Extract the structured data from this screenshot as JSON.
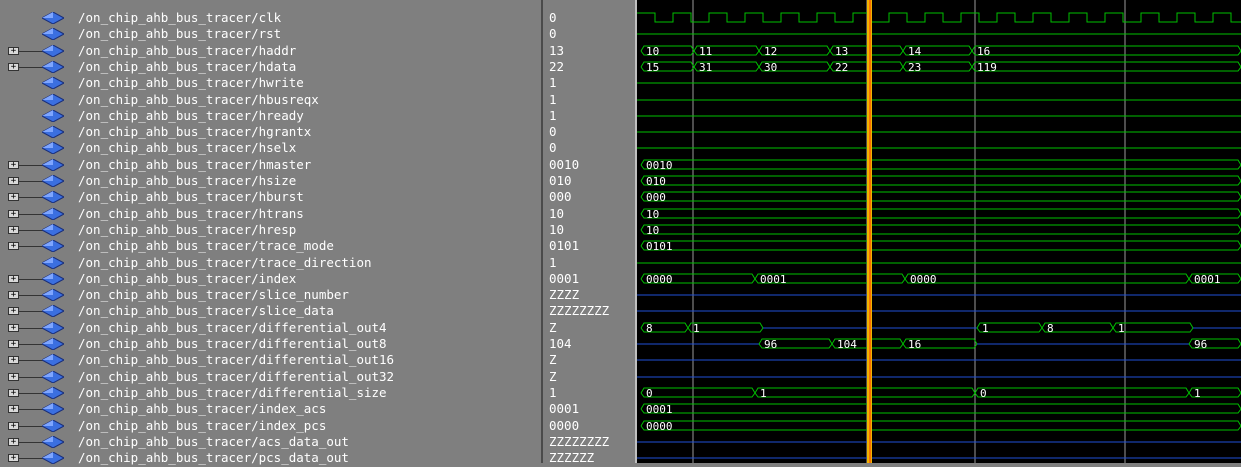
{
  "signals": [
    {
      "name": "/on_chip_ahb_bus_tracer/clk",
      "value": "0",
      "bus": false
    },
    {
      "name": "/on_chip_ahb_bus_tracer/rst",
      "value": "0",
      "bus": false
    },
    {
      "name": "/on_chip_ahb_bus_tracer/haddr",
      "value": "13",
      "bus": true
    },
    {
      "name": "/on_chip_ahb_bus_tracer/hdata",
      "value": "22",
      "bus": true
    },
    {
      "name": "/on_chip_ahb_bus_tracer/hwrite",
      "value": "1",
      "bus": false
    },
    {
      "name": "/on_chip_ahb_bus_tracer/hbusreqx",
      "value": "1",
      "bus": false
    },
    {
      "name": "/on_chip_ahb_bus_tracer/hready",
      "value": "1",
      "bus": false
    },
    {
      "name": "/on_chip_ahb_bus_tracer/hgrantx",
      "value": "0",
      "bus": false
    },
    {
      "name": "/on_chip_ahb_bus_tracer/hselx",
      "value": "0",
      "bus": false
    },
    {
      "name": "/on_chip_ahb_bus_tracer/hmaster",
      "value": "0010",
      "bus": true
    },
    {
      "name": "/on_chip_ahb_bus_tracer/hsize",
      "value": "010",
      "bus": true
    },
    {
      "name": "/on_chip_ahb_bus_tracer/hburst",
      "value": "000",
      "bus": true
    },
    {
      "name": "/on_chip_ahb_bus_tracer/htrans",
      "value": "10",
      "bus": true
    },
    {
      "name": "/on_chip_ahb_bus_tracer/hresp",
      "value": "10",
      "bus": true
    },
    {
      "name": "/on_chip_ahb_bus_tracer/trace_mode",
      "value": "0101",
      "bus": true
    },
    {
      "name": "/on_chip_ahb_bus_tracer/trace_direction",
      "value": "1",
      "bus": false
    },
    {
      "name": "/on_chip_ahb_bus_tracer/index",
      "value": "0001",
      "bus": true
    },
    {
      "name": "/on_chip_ahb_bus_tracer/slice_number",
      "value": "ZZZZ",
      "bus": true
    },
    {
      "name": "/on_chip_ahb_bus_tracer/slice_data",
      "value": "ZZZZZZZZ",
      "bus": true
    },
    {
      "name": "/on_chip_ahb_bus_tracer/differential_out4",
      "value": "Z",
      "bus": true
    },
    {
      "name": "/on_chip_ahb_bus_tracer/differential_out8",
      "value": "104",
      "bus": true
    },
    {
      "name": "/on_chip_ahb_bus_tracer/differential_out16",
      "value": "Z",
      "bus": true
    },
    {
      "name": "/on_chip_ahb_bus_tracer/differential_out32",
      "value": "Z",
      "bus": true
    },
    {
      "name": "/on_chip_ahb_bus_tracer/differential_size",
      "value": "1",
      "bus": true
    },
    {
      "name": "/on_chip_ahb_bus_tracer/index_acs",
      "value": "0001",
      "bus": true
    },
    {
      "name": "/on_chip_ahb_bus_tracer/index_pcs",
      "value": "0000",
      "bus": true
    },
    {
      "name": "/on_chip_ahb_bus_tracer/acs_data_out",
      "value": "ZZZZZZZZ",
      "bus": true
    },
    {
      "name": "/on_chip_ahb_bus_tracer/pcs_data_out",
      "value": "ZZZZZZ",
      "bus": true
    }
  ],
  "colors": {
    "wave": "#00c000",
    "highz": "#1f4fd6",
    "cursor": "#f0b400",
    "grid": "#9a9a9a",
    "name_bg": "#7f7f7f",
    "text": "#ffffff"
  },
  "waves": {
    "haddr": [
      "10",
      "11",
      "12",
      "13",
      "14",
      "16"
    ],
    "hdata": [
      "15",
      "31",
      "30",
      "22",
      "23",
      "119"
    ],
    "hmaster": [
      "0010"
    ],
    "hsize": [
      "010"
    ],
    "hburst": [
      "000"
    ],
    "htrans": [
      "10"
    ],
    "hresp": [
      "10"
    ],
    "trace_mode": [
      "0101"
    ],
    "index": [
      "0000",
      "0001",
      "0000",
      "0001"
    ],
    "differential_out4": [
      "8",
      "1",
      "1",
      "8",
      "1"
    ],
    "differential_out8": [
      "96",
      "104",
      "16",
      "96"
    ],
    "differential_size": [
      "0",
      "1",
      "0",
      "1"
    ],
    "index_acs": [
      "0001"
    ],
    "index_pcs": [
      "0000"
    ]
  }
}
